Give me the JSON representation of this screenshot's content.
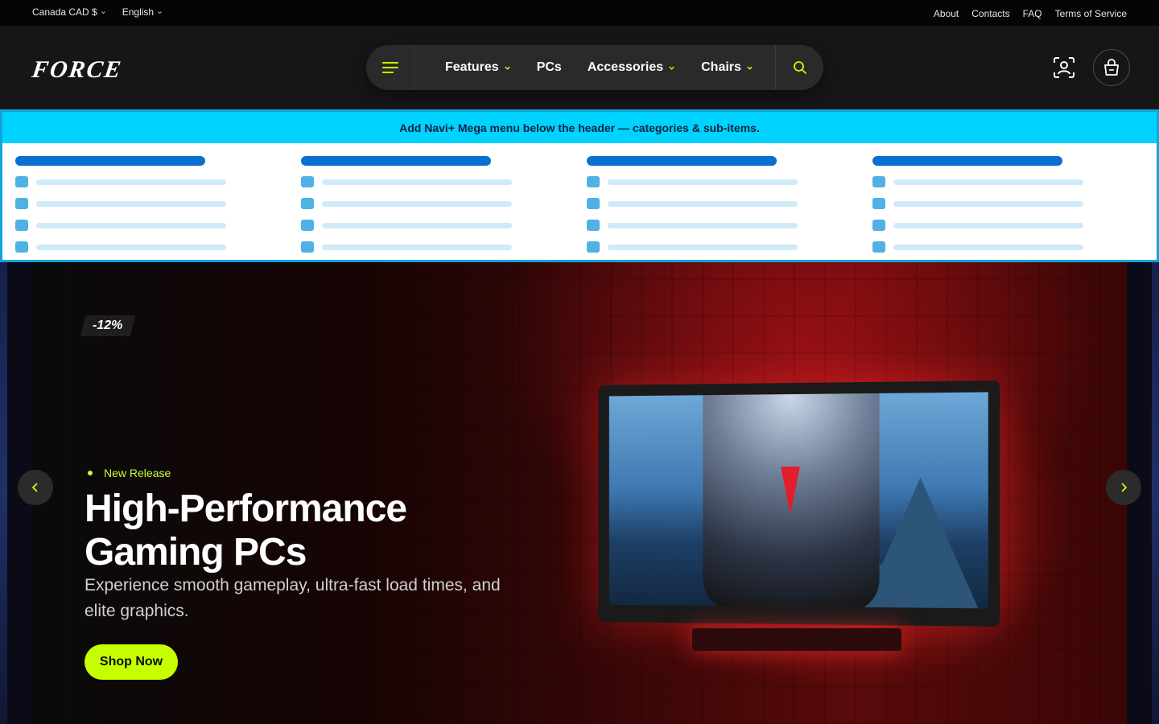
{
  "topbar": {
    "currency": "Canada CAD $",
    "language": "English",
    "links": [
      "About",
      "Contacts",
      "FAQ",
      "Terms of Service"
    ]
  },
  "header": {
    "logo": "FORCE",
    "nav": [
      {
        "label": "Features",
        "has_dropdown": true
      },
      {
        "label": "PCs",
        "has_dropdown": false
      },
      {
        "label": "Accessories",
        "has_dropdown": true
      },
      {
        "label": "Chairs",
        "has_dropdown": true
      }
    ],
    "icons": [
      "menu-icon",
      "search-icon",
      "account-icon",
      "cart-icon"
    ]
  },
  "mega_menu": {
    "banner": "Add Navi+ Mega menu below the header — categories & sub-items.",
    "columns": 4,
    "rows_per_column": 4
  },
  "hero": {
    "discount_badge": "-12%",
    "tag": "New Release",
    "title": "High-Performance Gaming PCs",
    "subtitle": "Experience smooth gameplay, ultra-fast load times, and elite graphics.",
    "cta": "Shop Now"
  },
  "colors": {
    "accent": "#c6ff00",
    "banner": "#00d2ff",
    "placeholder_head": "#0a6fd1",
    "background": "#161616"
  }
}
